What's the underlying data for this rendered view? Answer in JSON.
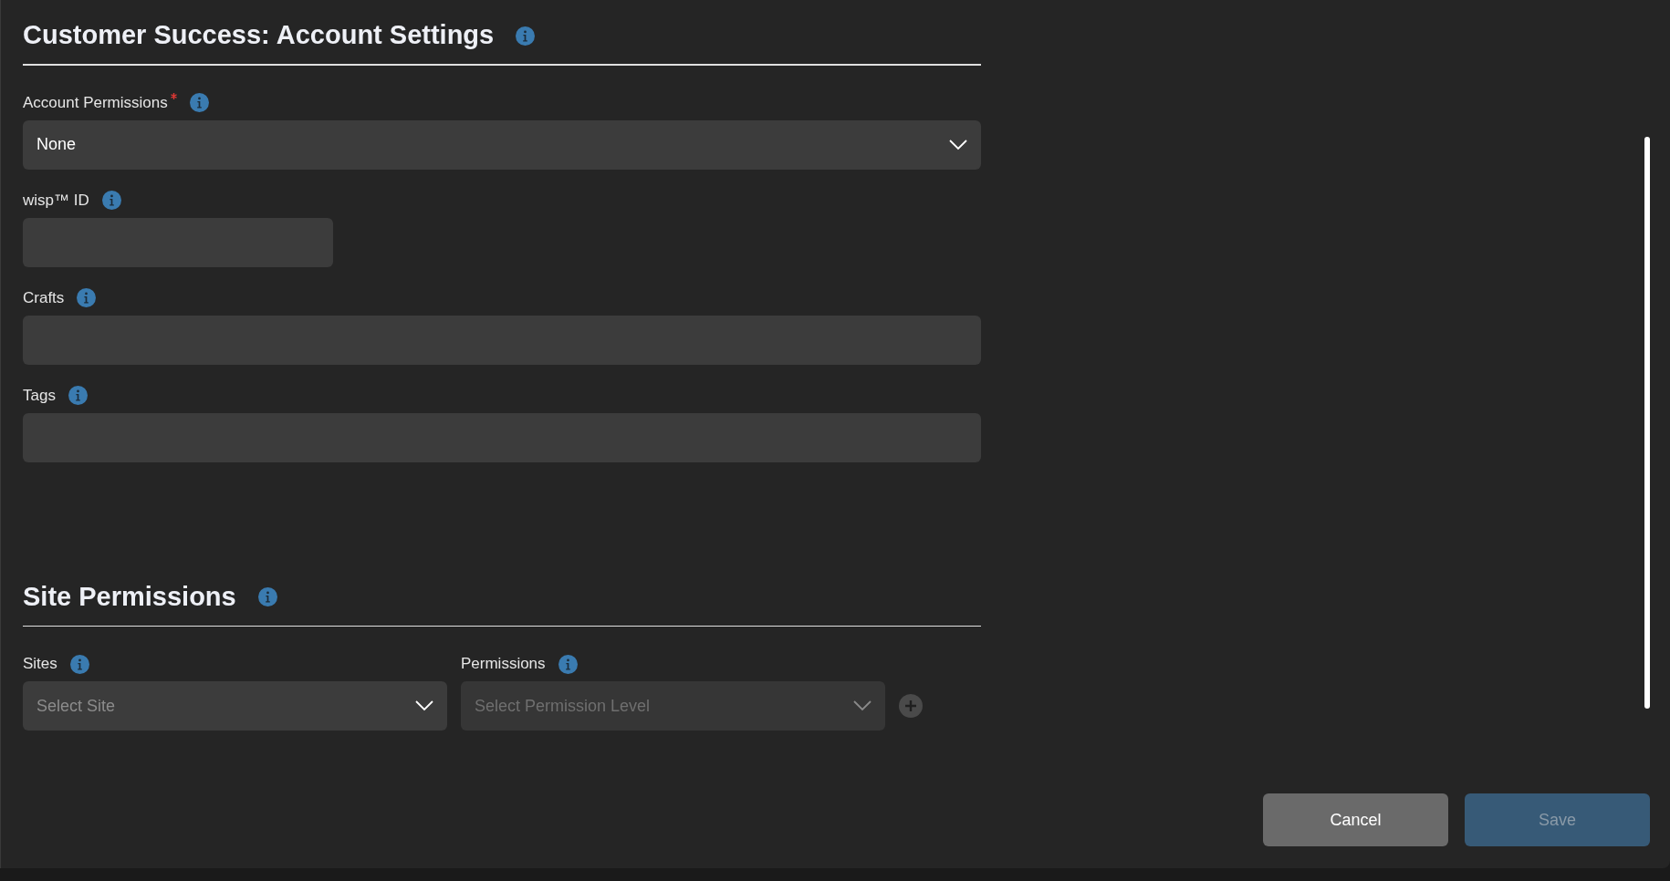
{
  "account_section": {
    "title": "Customer Success: Account Settings",
    "fields": [
      {
        "kind": "select",
        "label": "Account Permissions",
        "required": true,
        "value": "None",
        "disabled": false
      },
      {
        "kind": "short_input",
        "label": "wisp™ ID",
        "required": false
      },
      {
        "kind": "input",
        "label": "Crafts",
        "required": false
      },
      {
        "kind": "input",
        "label": "Tags",
        "required": false
      }
    ]
  },
  "site_section": {
    "title": "Site Permissions",
    "fields": [
      {
        "label": "Sites",
        "placeholder": "Select Site",
        "disabled": false
      },
      {
        "label": "Permissions",
        "placeholder": "Select Permission Level",
        "disabled": true
      }
    ]
  },
  "buttons": [
    {
      "label": "Cancel",
      "kind": "secondary",
      "disabled": false
    },
    {
      "label": "Save",
      "kind": "primary",
      "disabled": true
    }
  ]
}
